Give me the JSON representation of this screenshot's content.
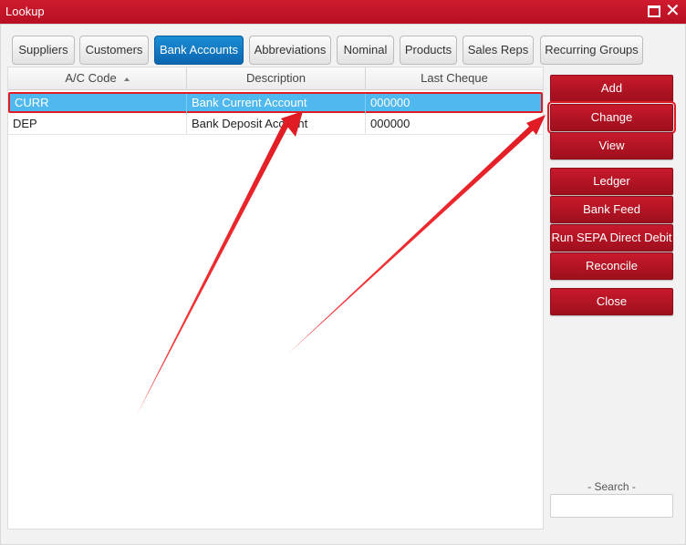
{
  "window": {
    "title": "Lookup"
  },
  "tabs": [
    {
      "label": "Suppliers",
      "active": false
    },
    {
      "label": "Customers",
      "active": false
    },
    {
      "label": "Bank Accounts",
      "active": true
    },
    {
      "label": "Abbreviations",
      "active": false
    },
    {
      "label": "Nominal",
      "active": false
    },
    {
      "label": "Products",
      "active": false
    },
    {
      "label": "Sales Reps",
      "active": false
    },
    {
      "label": "Recurring Groups",
      "active": false
    }
  ],
  "grid": {
    "columns": [
      "A/C Code",
      "Description",
      "Last Cheque"
    ],
    "sort_column": "A/C Code",
    "rows": [
      {
        "code": "CURR",
        "description": "Bank Current Account",
        "last_cheque": "000000",
        "selected": true
      },
      {
        "code": "DEP",
        "description": "Bank Deposit Account",
        "last_cheque": "000000",
        "selected": false
      }
    ]
  },
  "actions": {
    "add": "Add",
    "change": "Change",
    "view": "View",
    "ledger": "Ledger",
    "bank_feed": "Bank Feed",
    "run_sepa": "Run SEPA Direct Debit",
    "reconcile": "Reconcile",
    "close": "Close"
  },
  "search": {
    "label": "- Search -",
    "value": ""
  },
  "colors": {
    "accent_red": "#c8102e",
    "tab_active_blue": "#0b66b0",
    "selection_blue": "#4fb8ee",
    "annotation_red": "#e01b24"
  }
}
